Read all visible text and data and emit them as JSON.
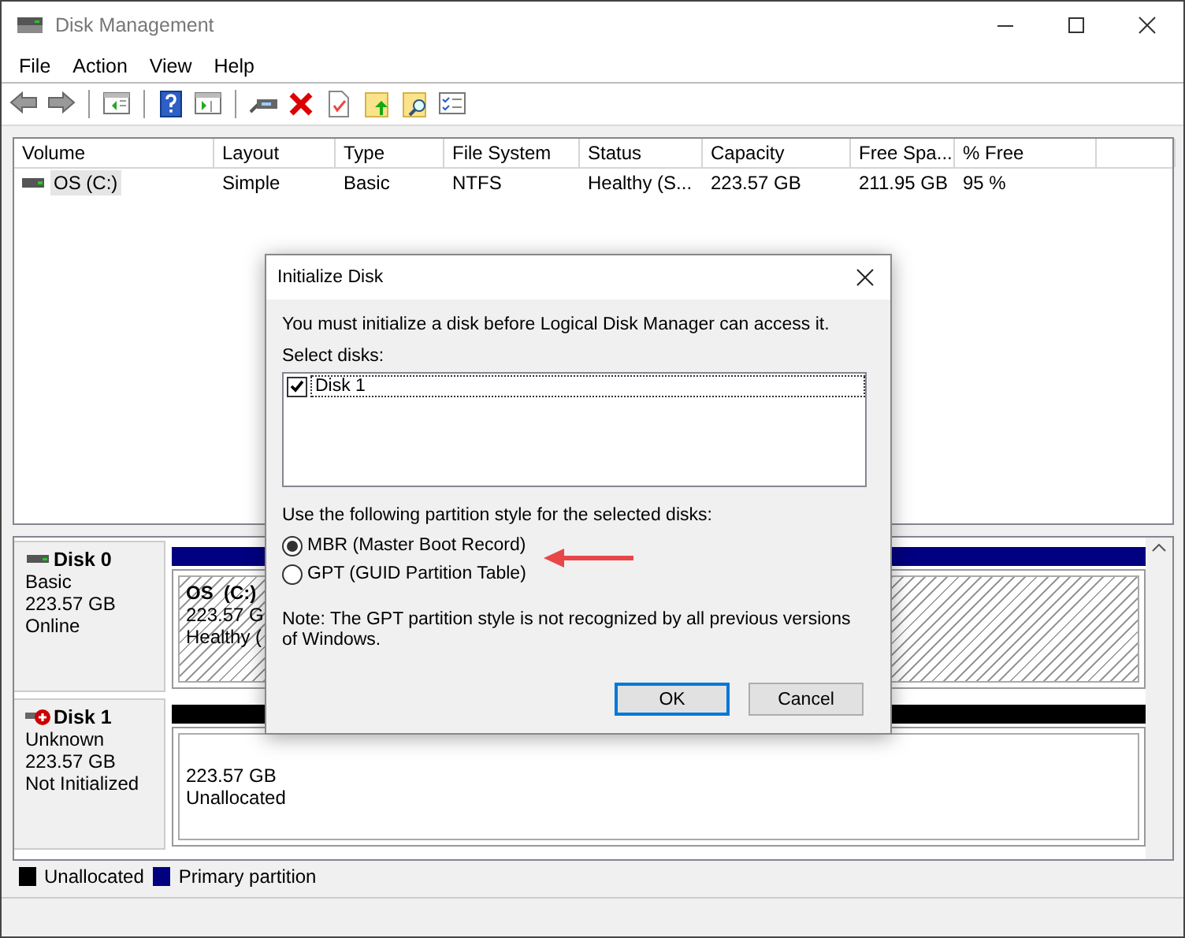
{
  "window": {
    "title": "Disk Management"
  },
  "menu": [
    "File",
    "Action",
    "View",
    "Help"
  ],
  "volumes": {
    "columns": [
      "Volume",
      "Layout",
      "Type",
      "File System",
      "Status",
      "Capacity",
      "Free Spa...",
      "% Free"
    ],
    "rows": [
      {
        "cells": [
          "OS (C:)",
          "Simple",
          "Basic",
          "NTFS",
          "Healthy (S...",
          "223.57 GB",
          "211.95 GB",
          "95 %"
        ],
        "selected": true
      }
    ]
  },
  "disks": [
    {
      "name": "Disk 0",
      "kind": "online",
      "lines": [
        "Basic",
        "223.57 GB",
        "Online"
      ],
      "partitions": [
        {
          "kind": "primary",
          "label": "OS  (C:)",
          "lines": [
            "223.57 G",
            "Healthy ("
          ]
        }
      ]
    },
    {
      "name": "Disk 1",
      "kind": "not_initialized",
      "lines": [
        "Unknown",
        "223.57 GB",
        "Not Initialized"
      ],
      "partitions": [
        {
          "kind": "unallocated",
          "lines": [
            "223.57 GB",
            "Unallocated"
          ]
        }
      ]
    }
  ],
  "legend": [
    {
      "label": "Unallocated",
      "color": "#000000"
    },
    {
      "label": "Primary partition",
      "color": "#000080"
    }
  ],
  "dialog": {
    "title": "Initialize Disk",
    "message": "You must initialize a disk before Logical Disk Manager can access it.",
    "select_label": "Select disks:",
    "disks": [
      {
        "label": "Disk 1",
        "checked": true,
        "selected": true
      }
    ],
    "style_label": "Use the following partition style for the selected disks:",
    "styles": [
      {
        "label": "MBR (Master Boot Record)",
        "selected": true
      },
      {
        "label": "GPT (GUID Partition Table)",
        "selected": false
      }
    ],
    "note": "Note: The GPT partition style is not recognized by all previous versions of Windows.",
    "buttons": [
      {
        "label": "OK",
        "default": true
      },
      {
        "label": "Cancel",
        "default": false
      }
    ]
  }
}
